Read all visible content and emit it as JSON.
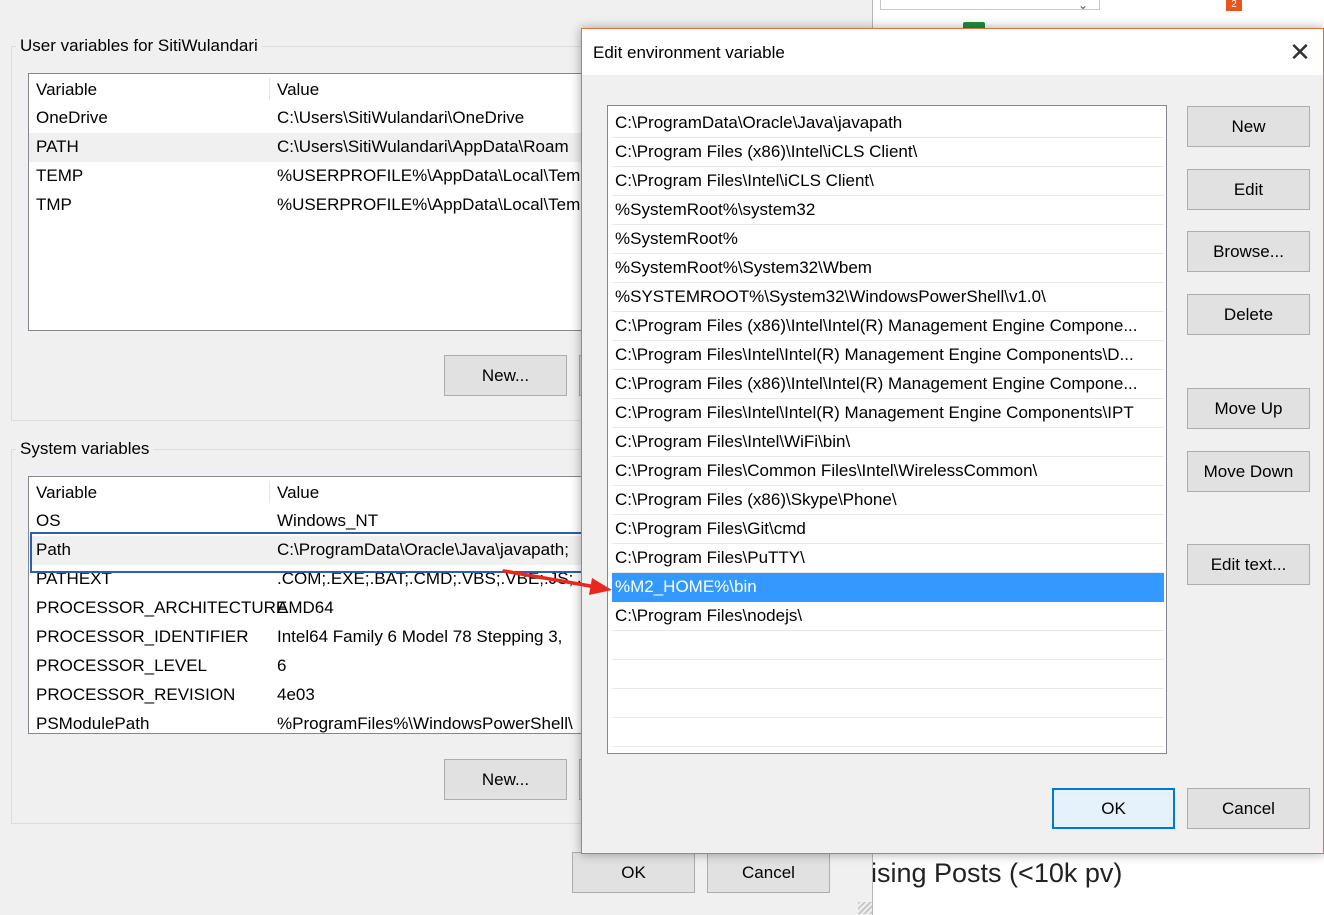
{
  "background": {
    "heading_fragment": "ising Posts (<10k pv)",
    "notification_count": "2"
  },
  "env_dialog": {
    "user_group_label": "User variables for SitiWulandari",
    "system_group_label": "System variables",
    "columns": {
      "variable": "Variable",
      "value": "Value"
    },
    "user_vars": [
      {
        "name": "OneDrive",
        "value": "C:\\Users\\SitiWulandari\\OneDrive"
      },
      {
        "name": "PATH",
        "value": "C:\\Users\\SitiWulandari\\AppData\\Roam"
      },
      {
        "name": "TEMP",
        "value": "%USERPROFILE%\\AppData\\Local\\Tem"
      },
      {
        "name": "TMP",
        "value": "%USERPROFILE%\\AppData\\Local\\Tem"
      }
    ],
    "system_vars": [
      {
        "name": "OS",
        "value": "Windows_NT"
      },
      {
        "name": "Path",
        "value": "C:\\ProgramData\\Oracle\\Java\\javapath;"
      },
      {
        "name": "PATHEXT",
        "value": ".COM;.EXE;.BAT;.CMD;.VBS;.VBE;.JS;.JSE"
      },
      {
        "name": "PROCESSOR_ARCHITECTURE",
        "value": "AMD64"
      },
      {
        "name": "PROCESSOR_IDENTIFIER",
        "value": "Intel64 Family 6 Model 78 Stepping 3,"
      },
      {
        "name": "PROCESSOR_LEVEL",
        "value": "6"
      },
      {
        "name": "PROCESSOR_REVISION",
        "value": "4e03"
      },
      {
        "name": "PSModulePath",
        "value": "%ProgramFiles%\\WindowsPowerShell\\"
      }
    ],
    "user_new_label": "New...",
    "system_new_label": "New...",
    "ok_label": "OK",
    "cancel_label": "Cancel"
  },
  "edit_dialog": {
    "title": "Edit environment variable",
    "entries": [
      "C:\\ProgramData\\Oracle\\Java\\javapath",
      "C:\\Program Files (x86)\\Intel\\iCLS Client\\",
      "C:\\Program Files\\Intel\\iCLS Client\\",
      "%SystemRoot%\\system32",
      "%SystemRoot%",
      "%SystemRoot%\\System32\\Wbem",
      "%SYSTEMROOT%\\System32\\WindowsPowerShell\\v1.0\\",
      "C:\\Program Files (x86)\\Intel\\Intel(R) Management Engine Compone...",
      "C:\\Program Files\\Intel\\Intel(R) Management Engine Components\\D...",
      "C:\\Program Files (x86)\\Intel\\Intel(R) Management Engine Compone...",
      "C:\\Program Files\\Intel\\Intel(R) Management Engine Components\\IPT",
      "C:\\Program Files\\Intel\\WiFi\\bin\\",
      "C:\\Program Files\\Common Files\\Intel\\WirelessCommon\\",
      "C:\\Program Files (x86)\\Skype\\Phone\\",
      "C:\\Program Files\\Git\\cmd",
      "C:\\Program Files\\PuTTY\\",
      "%M2_HOME%\\bin",
      "C:\\Program Files\\nodejs\\"
    ],
    "selected_index": 16,
    "buttons": {
      "new": "New",
      "edit": "Edit",
      "browse": "Browse...",
      "delete": "Delete",
      "move_up": "Move Up",
      "move_down": "Move Down",
      "edit_text": "Edit text...",
      "ok": "OK",
      "cancel": "Cancel"
    }
  }
}
